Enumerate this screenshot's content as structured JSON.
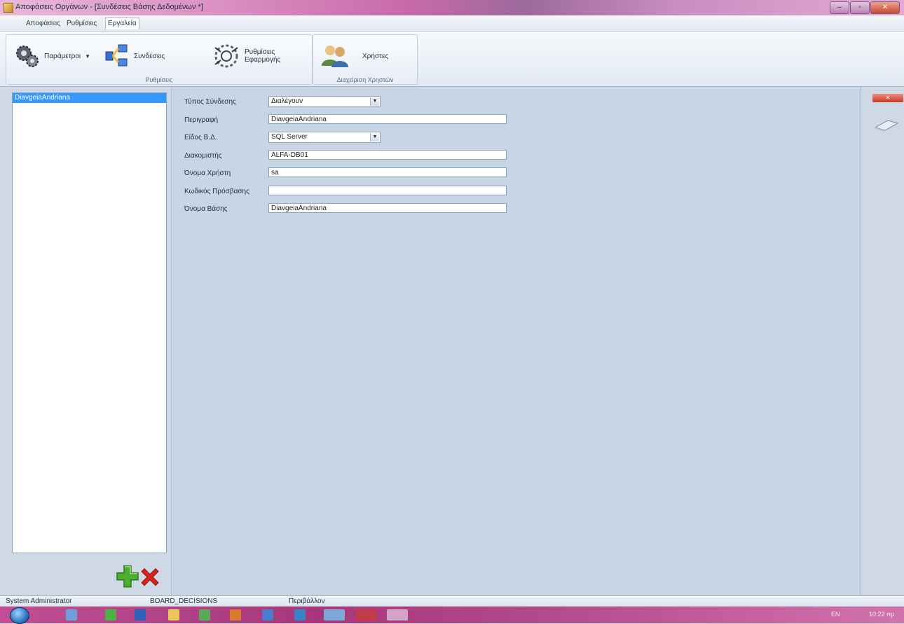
{
  "window": {
    "title": "Αποφάσεις Οργάνων - [Συνδέσεις Βάσης Δεδομένων *]",
    "controls": {
      "minimize": "–",
      "maximize": "▫",
      "close": "✕"
    }
  },
  "menu": {
    "tabs": [
      {
        "label": "Αποφάσεις"
      },
      {
        "label": "Ρυθμίσεις"
      },
      {
        "label": "Εργαλεία"
      }
    ]
  },
  "ribbon": {
    "groups": [
      {
        "label": "Ρυθμίσεις",
        "buttons": [
          {
            "label": "Παράμετροι",
            "icon": "gears-icon"
          },
          {
            "label": "Συνδέσεις",
            "icon": "network-icon"
          },
          {
            "label_line1": "Ρυθμίσεις",
            "label_line2": "Εφαρμογής",
            "icon": "app-settings-icon"
          }
        ]
      },
      {
        "label": "Διαχείριση Χρηστών",
        "buttons": [
          {
            "label": "Χρήστες",
            "icon": "users-icon"
          }
        ]
      }
    ]
  },
  "connections": {
    "items": [
      {
        "label": "DiavgeiaAndriana"
      }
    ]
  },
  "form": {
    "connection_type": {
      "label": "Τύπος Σύνδεσης",
      "value": "Διαλέγουν"
    },
    "description": {
      "label": "Περιγραφή",
      "value": "DiavgeiaAndriana"
    },
    "db_type": {
      "label": "Είδος Β.Δ.",
      "value": "SQL Server"
    },
    "server": {
      "label": "Διακομιστής",
      "value": "ALFA-DB01"
    },
    "username": {
      "label": "Όνομα Χρήστη",
      "value": "sa"
    },
    "password": {
      "label": "Κωδικός Πρόσβασης",
      "value": ""
    },
    "database": {
      "label": "Όνομα Βάσης",
      "value": "DiavgeiaAndriana"
    }
  },
  "statusbar": {
    "user": "System Administrator",
    "database": "BOARD_DECISIONS",
    "section": "Περιβάλλον"
  },
  "taskbar": {
    "language": "EN",
    "clock": "10:22 πμ"
  },
  "colors": {
    "selection": "#3399ff",
    "add_icon": "#4caf30",
    "delete_icon": "#d8231e",
    "taskbar": "#b24a8b"
  }
}
